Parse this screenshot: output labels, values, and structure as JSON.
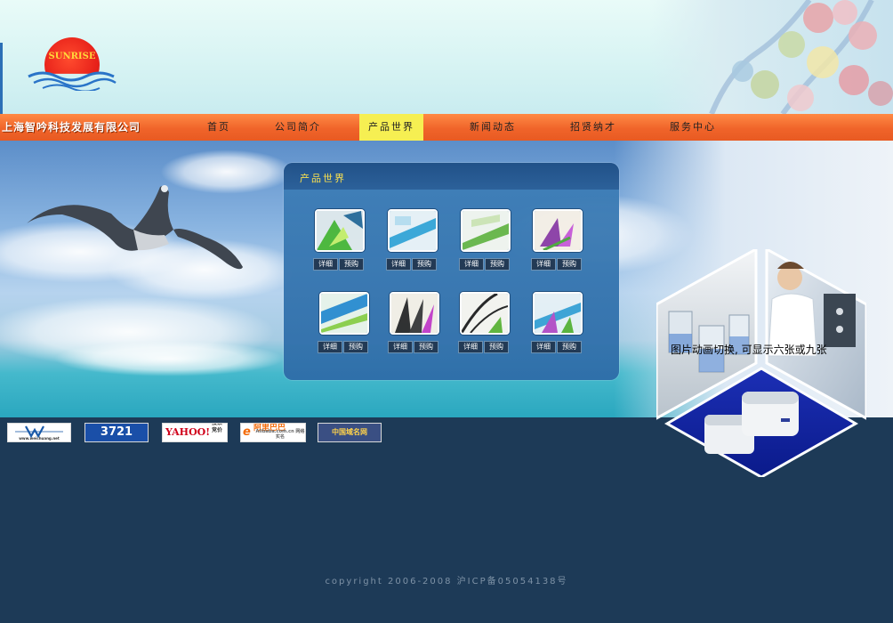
{
  "logo": {
    "text": "SUNRISE"
  },
  "company_name": "上海智吟科技发展有限公司",
  "nav": {
    "items": [
      {
        "label": "首页"
      },
      {
        "label": "公司简介"
      },
      {
        "label": "产品世界"
      },
      {
        "label": "新闻动态"
      },
      {
        "label": "招贤纳才"
      },
      {
        "label": "服务中心"
      }
    ],
    "active_index": 2
  },
  "products": {
    "title": "产品世界",
    "detail_label": "详细",
    "order_label": "预购",
    "count": 8
  },
  "hex_caption": "图片动画切换, 可显示六张或九张",
  "links": [
    {
      "name": "weichuang",
      "label": "W",
      "sub": "www.weichuang.net"
    },
    {
      "name": "3721",
      "label": "3721"
    },
    {
      "name": "yahoo",
      "label": "YAHOO!",
      "sub": "搜索 竞价"
    },
    {
      "name": "alibaba",
      "label": "阿里巴巴",
      "sub": "Alibaba.com.cn 网络实名"
    },
    {
      "name": "china-domain",
      "label": "中国域名网"
    }
  ],
  "copyright": "copyright 2006-2008 沪ICP备05054138号",
  "colors": {
    "nav_bg": "#f0642a",
    "nav_active": "#f6ef52",
    "panel_bg": "#2f6ea9",
    "panel_title": "#ffe34a",
    "footer_bg": "#1d3a57"
  }
}
